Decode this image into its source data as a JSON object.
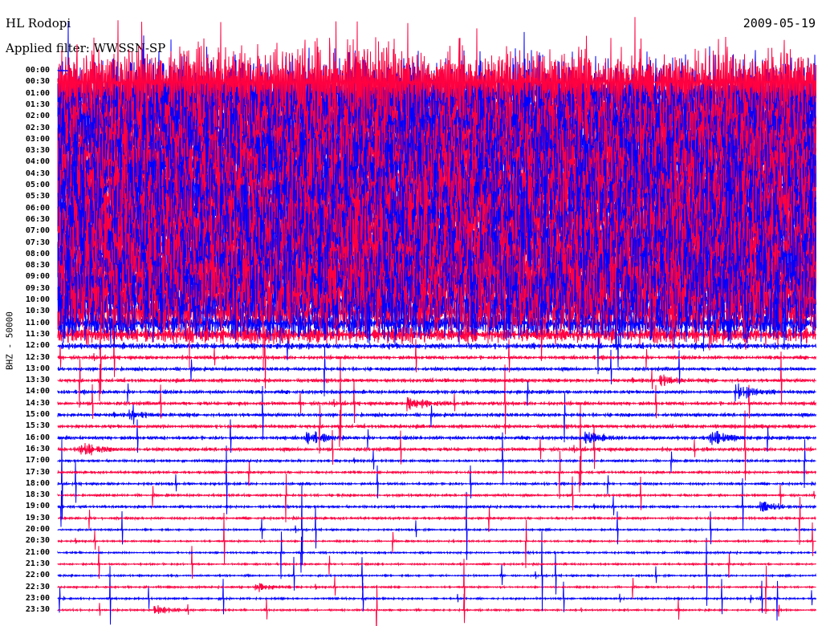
{
  "header": {
    "station": "HL Rodopi",
    "filter": "Applied filter: WWSSN-SP",
    "date": "2009-05-19"
  },
  "chart_data": {
    "type": "line",
    "title": "HL Rodopi",
    "subtitle": "Applied filter: WWSSN-SP",
    "ylabel": "BHZ - 50000",
    "xlabel": "",
    "colors": {
      "even": "#0000ff",
      "odd": "#ff0040"
    },
    "rows": [
      "00:00",
      "00:30",
      "01:00",
      "01:30",
      "02:00",
      "02:30",
      "03:00",
      "03:30",
      "04:00",
      "04:30",
      "05:00",
      "05:30",
      "06:00",
      "06:30",
      "07:00",
      "07:30",
      "08:00",
      "08:30",
      "09:00",
      "09:30",
      "10:00",
      "10:30",
      "11:00",
      "11:30",
      "12:00",
      "12:30",
      "13:00",
      "13:30",
      "14:00",
      "14:30",
      "15:00",
      "15:30",
      "16:00",
      "16:30",
      "17:00",
      "17:30",
      "18:00",
      "18:30",
      "19:00",
      "19:30",
      "20:00",
      "20:30",
      "21:00",
      "21:30",
      "22:00",
      "22:30",
      "23:00",
      "23:30"
    ],
    "noise_level": [
      1,
      60,
      60,
      60,
      60,
      60,
      60,
      60,
      60,
      60,
      60,
      60,
      60,
      60,
      60,
      60,
      60,
      60,
      60,
      60,
      60,
      30,
      22,
      14,
      5,
      3,
      3,
      3,
      3,
      3,
      3,
      3,
      3,
      3,
      2,
      2,
      2,
      2,
      2,
      2,
      1.5,
      1.5,
      1.5,
      1.5,
      1.5,
      1.5,
      1.5,
      1.5
    ],
    "events": [
      {
        "row": 32,
        "minute": 10,
        "amp": 8
      },
      {
        "row": 32,
        "minute": 21,
        "amp": 7
      },
      {
        "row": 32,
        "minute": 26,
        "amp": 8
      },
      {
        "row": 33,
        "minute": 1,
        "amp": 9
      },
      {
        "row": 28,
        "minute": 27,
        "amp": 10
      },
      {
        "row": 38,
        "minute": 28,
        "amp": 8
      },
      {
        "row": 29,
        "minute": 14,
        "amp": 9
      },
      {
        "row": 45,
        "minute": 8,
        "amp": 5
      },
      {
        "row": 47,
        "minute": 4,
        "amp": 5
      },
      {
        "row": 30,
        "minute": 3,
        "amp": 5
      },
      {
        "row": 27,
        "minute": 24,
        "amp": 6
      }
    ]
  }
}
